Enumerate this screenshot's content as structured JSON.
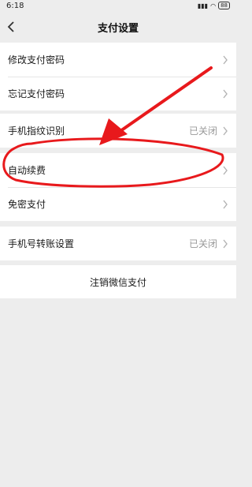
{
  "status_bar": {
    "time": "6:18",
    "battery": "88"
  },
  "nav": {
    "title": "支付设置"
  },
  "groups": [
    {
      "items": [
        {
          "label": "修改支付密码",
          "status": ""
        },
        {
          "label": "忘记支付密码",
          "status": ""
        }
      ]
    },
    {
      "items": [
        {
          "label": "手机指纹识别",
          "status": "已关闭"
        }
      ]
    },
    {
      "items": [
        {
          "label": "自动续费",
          "status": ""
        },
        {
          "label": "免密支付",
          "status": ""
        }
      ]
    },
    {
      "items": [
        {
          "label": "手机号转账设置",
          "status": "已关闭"
        }
      ]
    }
  ],
  "logout_label": "注销微信支付",
  "colors": {
    "annotation": "#e8191c",
    "background": "#ededed",
    "status_text": "#999999"
  }
}
